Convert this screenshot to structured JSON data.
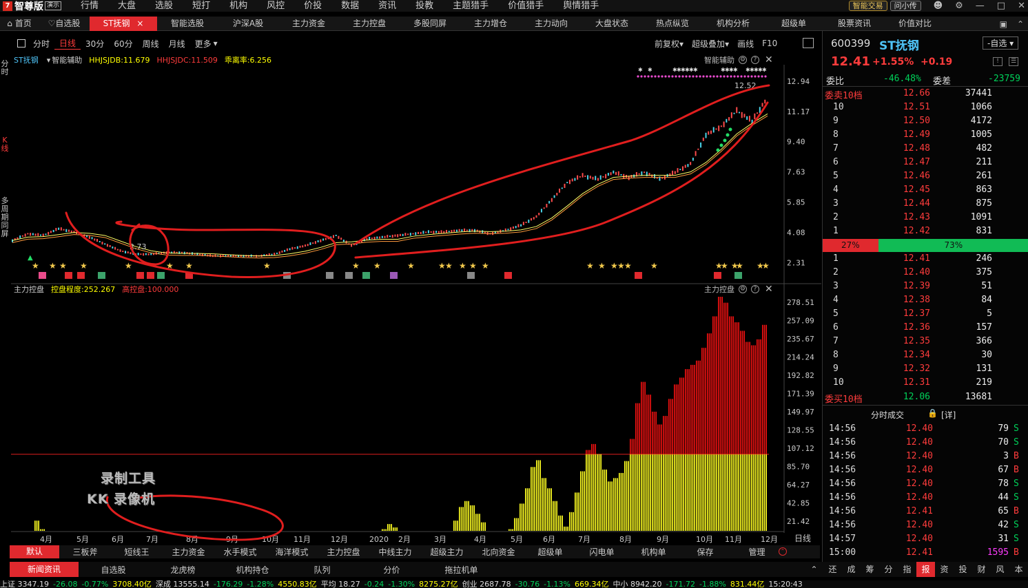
{
  "app": {
    "brand_mark": "7",
    "name": "智尊版",
    "badge": "演示"
  },
  "menu": [
    "行情",
    "大盘",
    "选股",
    "短打",
    "机构",
    "风控",
    "价投",
    "数据",
    "资讯",
    "投教",
    "主题猎手",
    "价值猎手",
    "舆情猎手"
  ],
  "menu_right": {
    "smart_trade": "智能交易",
    "ask": "问小传"
  },
  "tabs": [
    "首页",
    "自选股",
    "ST抚钢",
    "智能选股",
    "沪深A股",
    "主力资金",
    "主力控盘",
    "多股同屏",
    "主力增仓",
    "主力动向",
    "大盘状态",
    "热点纵览",
    "机构分析",
    "超级单",
    "股票资讯",
    "价值对比"
  ],
  "active_tab": "ST抚钢",
  "left_strip": {
    "a": "分时",
    "b": "K线",
    "c": "多周期同屏"
  },
  "periods": [
    "分时",
    "日线",
    "30分",
    "60分",
    "周线",
    "月线",
    "更多"
  ],
  "active_period": "日线",
  "chart_tools": [
    "前复权",
    "超级叠加",
    "画线",
    "F10"
  ],
  "ind1": {
    "name": "ST抚钢",
    "aux": "智能辅助",
    "l1": "HHJSJDB:11.679",
    "l2": "HHJSJDC:11.509",
    "l3": "乖离率:6.256",
    "right": "智能辅助"
  },
  "ind2": {
    "name": "主力控盘",
    "l1": "控盘程度:252.267",
    "l2": "高控盘:100.000",
    "right": "主力控盘"
  },
  "watermark": {
    "line1": "录制工具",
    "line2": "KK 录像机"
  },
  "chart_data": [
    {
      "type": "line",
      "title": "ST抚钢 日线",
      "ylim": [
        1.8,
        13.5
      ],
      "y_ticks": [
        "12.94",
        "11.17",
        "9.40",
        "7.63",
        "5.85",
        "4.08",
        "2.31"
      ],
      "labels": {
        "high": "12.52",
        "low": "2.73"
      },
      "series": [
        {
          "values": [
            3.6,
            4.0,
            3.9,
            4.3,
            4.1,
            3.8,
            3.4,
            3.0,
            2.8,
            2.8,
            2.9,
            2.9,
            2.8,
            2.7,
            2.7,
            2.7,
            2.7,
            2.8,
            3.1,
            3.3,
            3.6,
            3.9,
            3.3,
            3.7,
            3.8,
            3.9,
            4.0,
            4.1,
            4.1,
            4.2,
            4.2,
            4.0,
            4.2,
            4.5,
            5.0,
            6.0,
            7.0,
            7.4,
            7.2,
            7.6,
            7.3,
            7.6,
            7.2,
            7.6,
            8.1,
            9.8,
            10.3,
            11.2,
            10.6,
            12.0
          ]
        }
      ]
    },
    {
      "type": "bar",
      "title": "主力控盘",
      "ylim": [
        10,
        285
      ],
      "threshold": 100,
      "y_ticks": [
        "278.51",
        "257.09",
        "235.67",
        "214.24",
        "192.82",
        "171.39",
        "149.97",
        "128.55",
        "107.12",
        "85.70",
        "64.27",
        "42.85",
        "21.42"
      ],
      "categories": [
        "4月",
        "5月",
        "6月",
        "7月",
        "8月",
        "9月",
        "10月",
        "11月",
        "12月",
        "2020",
        "2月",
        "3月",
        "4月",
        "5月",
        "6月",
        "7月",
        "8月",
        "9月",
        "10月",
        "11月",
        "12月"
      ],
      "x_axis_end": "日线",
      "values": [
        0,
        0,
        0,
        10,
        22,
        12,
        0,
        0,
        0,
        0,
        0,
        0,
        0,
        0,
        0,
        0,
        0,
        0,
        0,
        0,
        0,
        0,
        0,
        0,
        0,
        0,
        0,
        0,
        0,
        0,
        0,
        0,
        0,
        0,
        0,
        0,
        0,
        0,
        0,
        0,
        0,
        0,
        0,
        0,
        0,
        0,
        0,
        0,
        0,
        0,
        0,
        0,
        0,
        0,
        0,
        0,
        0,
        0,
        0,
        0,
        0,
        0,
        0,
        0,
        0,
        0,
        0,
        12,
        18,
        14,
        0,
        0,
        0,
        0,
        0,
        0,
        0,
        0,
        0,
        0,
        22,
        38,
        45,
        40,
        30,
        20,
        0,
        0,
        0,
        5,
        12,
        25,
        42,
        60,
        85,
        93,
        72,
        60,
        45,
        28,
        15,
        32,
        55,
        80,
        105,
        112,
        100,
        82,
        68,
        72,
        78,
        92,
        118,
        160,
        185,
        170,
        150,
        135,
        145,
        165,
        182,
        190,
        200,
        205,
        210,
        225,
        242,
        262,
        285,
        278,
        262,
        255,
        245,
        232,
        228,
        235,
        252
      ]
    }
  ],
  "quote": {
    "code": "600399",
    "name": "ST抚钢",
    "selfselect": "-自选",
    "price": "12.41",
    "pct": "+1.55%",
    "chg": "+0.19",
    "wb_label": "委比",
    "wb": "-46.48%",
    "wc_label": "委差",
    "wc": "-23759"
  },
  "sell_total": {
    "label": "委卖10档",
    "price": "12.66",
    "vol": "37441"
  },
  "asks": [
    {
      "lvl": "10",
      "price": "12.51",
      "vol": "1066"
    },
    {
      "lvl": "9",
      "price": "12.50",
      "vol": "4172"
    },
    {
      "lvl": "8",
      "price": "12.49",
      "vol": "1005"
    },
    {
      "lvl": "7",
      "price": "12.48",
      "vol": "482"
    },
    {
      "lvl": "6",
      "price": "12.47",
      "vol": "211"
    },
    {
      "lvl": "5",
      "price": "12.46",
      "vol": "261"
    },
    {
      "lvl": "4",
      "price": "12.45",
      "vol": "863"
    },
    {
      "lvl": "3",
      "price": "12.44",
      "vol": "875"
    },
    {
      "lvl": "2",
      "price": "12.43",
      "vol": "1091"
    },
    {
      "lvl": "1",
      "price": "12.42",
      "vol": "831"
    }
  ],
  "ratio": {
    "sell": "27%",
    "buy": "73%",
    "sell_frac": 0.27
  },
  "bids": [
    {
      "lvl": "1",
      "price": "12.41",
      "vol": "246"
    },
    {
      "lvl": "2",
      "price": "12.40",
      "vol": "375"
    },
    {
      "lvl": "3",
      "price": "12.39",
      "vol": "51"
    },
    {
      "lvl": "4",
      "price": "12.38",
      "vol": "84"
    },
    {
      "lvl": "5",
      "price": "12.37",
      "vol": "5"
    },
    {
      "lvl": "6",
      "price": "12.36",
      "vol": "157"
    },
    {
      "lvl": "7",
      "price": "12.35",
      "vol": "366"
    },
    {
      "lvl": "8",
      "price": "12.34",
      "vol": "30"
    },
    {
      "lvl": "9",
      "price": "12.32",
      "vol": "131"
    },
    {
      "lvl": "10",
      "price": "12.31",
      "vol": "219"
    }
  ],
  "buy_total": {
    "label": "委买10档",
    "price": "12.06",
    "vol": "13681"
  },
  "trades_header": {
    "title": "分时成交",
    "detail": "[详]"
  },
  "trades": [
    {
      "t": "14:56",
      "p": "12.40",
      "v": "79",
      "d": "S"
    },
    {
      "t": "14:56",
      "p": "12.40",
      "v": "70",
      "d": "S"
    },
    {
      "t": "14:56",
      "p": "12.40",
      "v": "3",
      "d": "B"
    },
    {
      "t": "14:56",
      "p": "12.40",
      "v": "67",
      "d": "B"
    },
    {
      "t": "14:56",
      "p": "12.40",
      "v": "78",
      "d": "S"
    },
    {
      "t": "14:56",
      "p": "12.40",
      "v": "44",
      "d": "S"
    },
    {
      "t": "14:56",
      "p": "12.41",
      "v": "65",
      "d": "B"
    },
    {
      "t": "14:56",
      "p": "12.40",
      "v": "42",
      "d": "S"
    },
    {
      "t": "14:57",
      "p": "12.40",
      "v": "31",
      "d": "S"
    },
    {
      "t": "15:00",
      "p": "12.41",
      "v": "1595",
      "d": "B"
    }
  ],
  "bottom_tabs1": [
    "默认",
    "三板斧",
    "短线王",
    "主力资金",
    "水手模式",
    "海洋模式",
    "主力控盘",
    "中线主力",
    "超级主力",
    "北向资金",
    "超级单",
    "闪电单",
    "机构单",
    "保存",
    "管理"
  ],
  "bottom_tabs2": [
    "新闻资讯",
    "自选股",
    "龙虎榜",
    "机构持仓",
    "队列",
    "分价",
    "拖拉机单"
  ],
  "mini_nav": [
    "还",
    "成",
    "筹",
    "分",
    "指",
    "报",
    "资",
    "投",
    "财",
    "风",
    "本"
  ],
  "mini_nav_active": "报",
  "status": [
    "上证 3347.19",
    "-26.08",
    "-0.77%",
    "3708.40亿",
    "深成 13555.14",
    "-176.29",
    "-1.28%",
    "4550.83亿",
    "平均 18.27",
    "-0.24",
    "-1.30%",
    "8275.27亿",
    "创业 2687.78",
    "-30.76",
    "-1.13%",
    "669.34亿",
    "中小 8942.20",
    "-171.72",
    "-1.88%",
    "831.44亿",
    "15:20:43"
  ],
  "colors": {
    "up": "#ff3c3c",
    "down": "#00d25a",
    "accent": "#e0292e",
    "yellow": "#ffff00",
    "cyan": "#4fc3f7"
  }
}
